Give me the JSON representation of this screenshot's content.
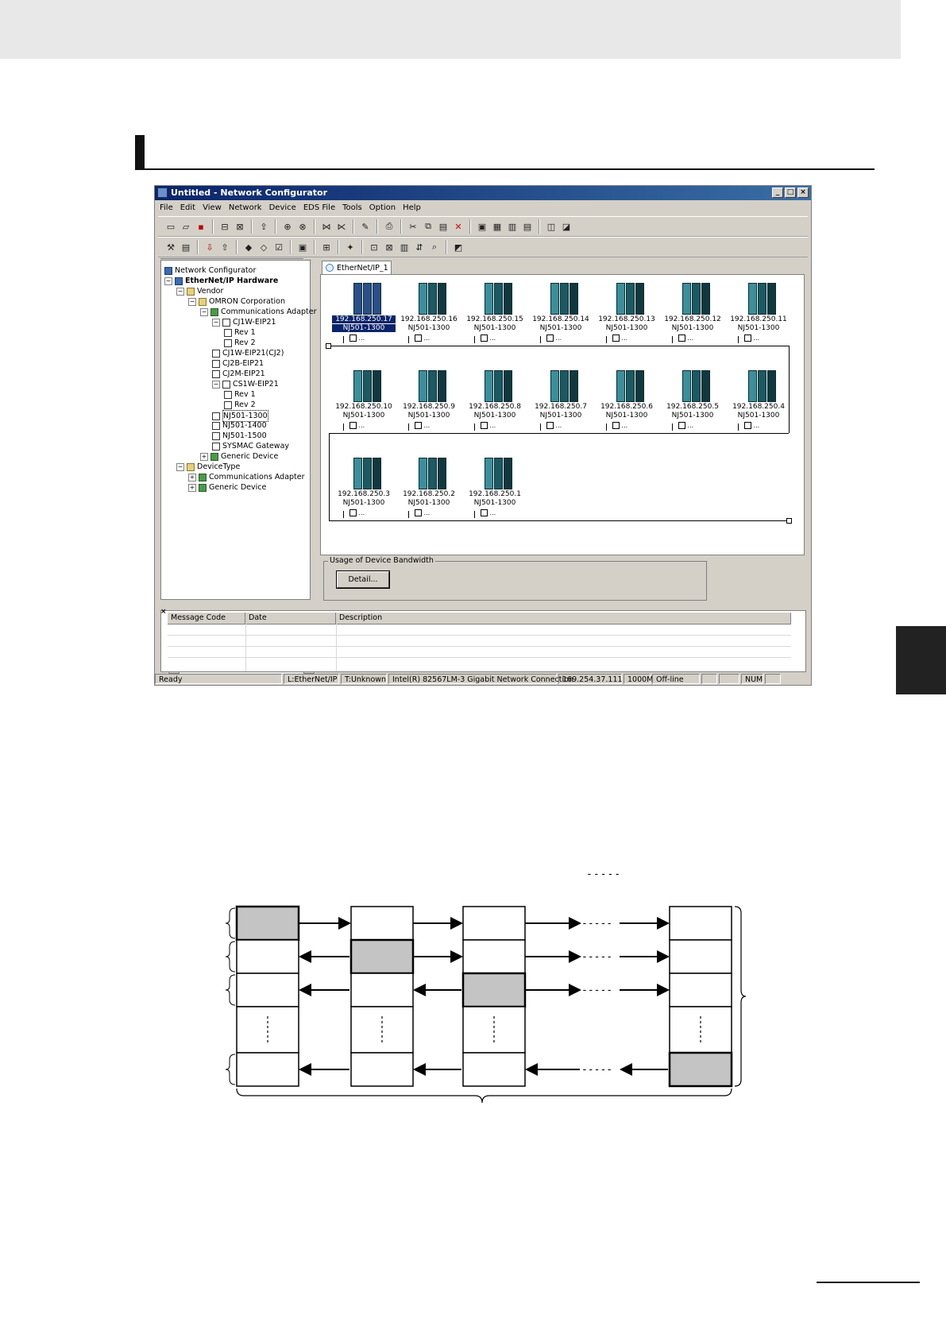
{
  "window": {
    "title": "Untitled - Network Configurator",
    "controls": [
      "_",
      "□",
      "×"
    ]
  },
  "menu": [
    "File",
    "Edit",
    "View",
    "Network",
    "Device",
    "EDS File",
    "Tools",
    "Option",
    "Help"
  ],
  "toolbar1_icons": [
    "new-icon",
    "open-icon",
    "save-icon",
    "sep",
    "online-icon",
    "offline-icon",
    "sep",
    "upload-icon",
    "sep",
    "compare-icon",
    "compare2-icon",
    "sep",
    "connect-icon",
    "disconnect-icon",
    "sep",
    "monitor-icon",
    "sep",
    "print-icon",
    "sep",
    "cut-icon",
    "copy-icon",
    "paste-icon",
    "delete-icon",
    "sep",
    "large-icon-view",
    "small-icon-view",
    "list-view",
    "detail-view",
    "sep",
    "property-icon",
    "parameter-icon"
  ],
  "toolbar2_icons": [
    "tools-icon",
    "memo-icon",
    "sep",
    "download-icon",
    "upload2-icon",
    "sep",
    "transfer-to-icon",
    "transfer-from-icon",
    "verify-icon",
    "sep",
    "register-icon",
    "sep",
    "monitor2-icon",
    "sep",
    "wizard-icon",
    "sep",
    "connection-icon",
    "edit-icon",
    "copy2-icon",
    "sort-icon",
    "find-icon",
    "sep",
    "eds-icon"
  ],
  "tree": {
    "nodes": [
      {
        "label": "Network Configurator",
        "level": 0,
        "icon": "network",
        "bold": false
      },
      {
        "label": "EtherNet/IP Hardware",
        "level": 0,
        "icon": "network",
        "bold": true,
        "exp": "-"
      },
      {
        "label": "Vendor",
        "level": 1,
        "icon": "folder",
        "exp": "-"
      },
      {
        "label": "OMRON Corporation",
        "level": 2,
        "icon": "folder",
        "exp": "-"
      },
      {
        "label": "Communications Adapter",
        "level": 3,
        "icon": "group",
        "exp": "-"
      },
      {
        "label": "CJ1W-EIP21",
        "level": 4,
        "icon": "device",
        "exp": "-"
      },
      {
        "label": "Rev 1",
        "level": 5,
        "icon": "device"
      },
      {
        "label": "Rev 2",
        "level": 5,
        "icon": "device"
      },
      {
        "label": "CJ1W-EIP21(CJ2)",
        "level": 4,
        "icon": "device"
      },
      {
        "label": "CJ2B-EIP21",
        "level": 4,
        "icon": "device"
      },
      {
        "label": "CJ2M-EIP21",
        "level": 4,
        "icon": "device"
      },
      {
        "label": "CS1W-EIP21",
        "level": 4,
        "icon": "device",
        "exp": "-"
      },
      {
        "label": "Rev 1",
        "level": 5,
        "icon": "device"
      },
      {
        "label": "Rev 2",
        "level": 5,
        "icon": "device"
      },
      {
        "label": "NJ501-1300",
        "level": 4,
        "icon": "device",
        "selected": true
      },
      {
        "label": "NJ501-1400",
        "level": 4,
        "icon": "device"
      },
      {
        "label": "NJ501-1500",
        "level": 4,
        "icon": "device"
      },
      {
        "label": "SYSMAC Gateway",
        "level": 4,
        "icon": "device"
      },
      {
        "label": "Generic Device",
        "level": 3,
        "icon": "group",
        "exp": "+"
      },
      {
        "label": "DeviceType",
        "level": 1,
        "icon": "folder",
        "exp": "-"
      },
      {
        "label": "Communications Adapter",
        "level": 2,
        "icon": "group",
        "exp": "+"
      },
      {
        "label": "Generic Device",
        "level": 2,
        "icon": "group",
        "exp": "+"
      }
    ]
  },
  "canvas": {
    "tab_label": "EtherNet/IP_1",
    "port_label": "...",
    "devices": [
      {
        "ip": "192.168.250.17",
        "model": "NJ501-1300",
        "selected": true
      },
      {
        "ip": "192.168.250.16",
        "model": "NJ501-1300"
      },
      {
        "ip": "192.168.250.15",
        "model": "NJ501-1300"
      },
      {
        "ip": "192.168.250.14",
        "model": "NJ501-1300"
      },
      {
        "ip": "192.168.250.13",
        "model": "NJ501-1300"
      },
      {
        "ip": "192.168.250.12",
        "model": "NJ501-1300"
      },
      {
        "ip": "192.168.250.11",
        "model": "NJ501-1300"
      },
      {
        "ip": "192.168.250.10",
        "model": "NJ501-1300"
      },
      {
        "ip": "192.168.250.9",
        "model": "NJ501-1300"
      },
      {
        "ip": "192.168.250.8",
        "model": "NJ501-1300"
      },
      {
        "ip": "192.168.250.7",
        "model": "NJ501-1300"
      },
      {
        "ip": "192.168.250.6",
        "model": "NJ501-1300"
      },
      {
        "ip": "192.168.250.5",
        "model": "NJ501-1300"
      },
      {
        "ip": "192.168.250.4",
        "model": "NJ501-1300"
      },
      {
        "ip": "192.168.250.3",
        "model": "NJ501-1300"
      },
      {
        "ip": "192.168.250.2",
        "model": "NJ501-1300"
      },
      {
        "ip": "192.168.250.1",
        "model": "NJ501-1300"
      }
    ]
  },
  "bandwidth": {
    "legend": "Usage of Device Bandwidth",
    "detail_button": "Detail..."
  },
  "messages": {
    "columns": [
      "Message Code",
      "Date",
      "Description"
    ]
  },
  "status": [
    "Ready",
    "L:EtherNet/IP",
    "T:Unknown",
    "Intel(R) 82567LM-3 Gigabit Network Connection",
    "169.254.37.111",
    "1000M",
    "Off-line",
    "",
    "",
    "NUM",
    ""
  ],
  "diagram": {
    "dots_legend": "-----",
    "dots": "-----"
  }
}
